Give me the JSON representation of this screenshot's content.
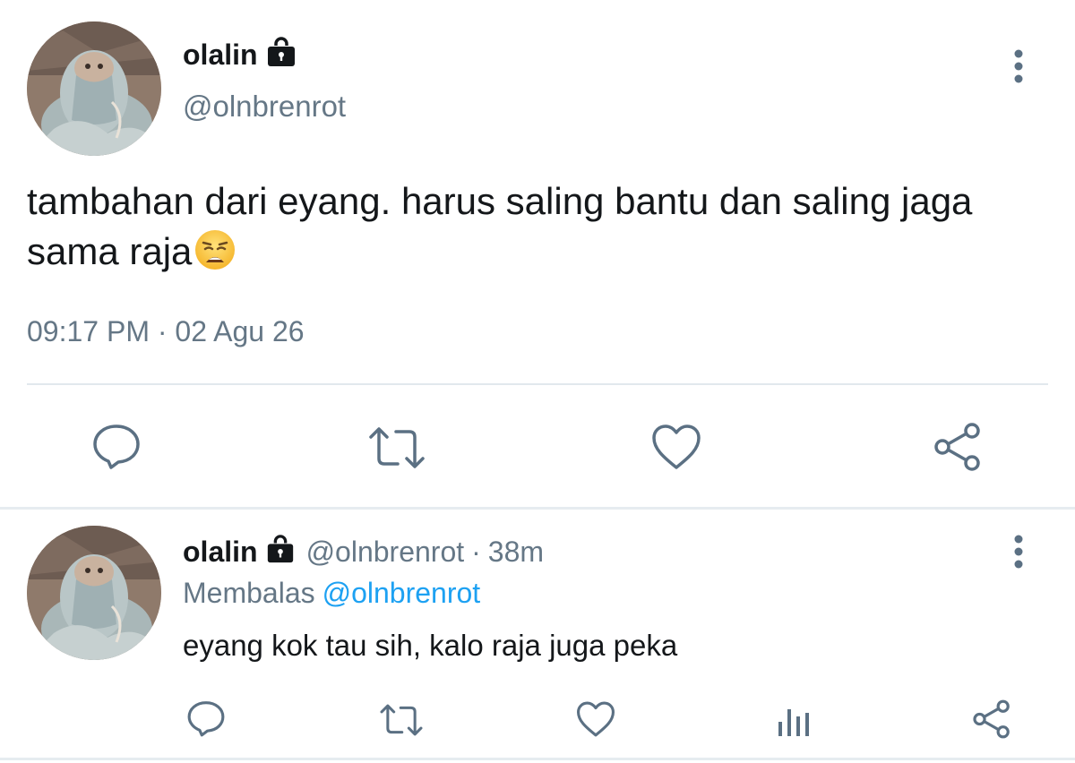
{
  "main_tweet": {
    "display_name": "olalin",
    "handle": "@olnbrenrot",
    "text": "tambahan dari eyang. harus saling bantu dan saling jaga sama raja",
    "emoji": "weary-face",
    "timestamp": "09:17 PM · 02 Agu 26",
    "protected_icon": "lock-icon",
    "actions": [
      "reply-icon",
      "retweet-icon",
      "like-icon",
      "share-icon"
    ]
  },
  "reply_tweet": {
    "display_name": "olalin",
    "handle": "@olnbrenrot",
    "separator": "·",
    "time_ago": "38m",
    "replying_prefix": "Membalas",
    "replying_to": "@olnbrenrot",
    "text": "eyang kok tau sih, kalo raja juga peka",
    "protected_icon": "lock-icon",
    "actions": [
      "reply-icon",
      "retweet-icon",
      "like-icon",
      "analytics-icon",
      "share-icon"
    ]
  },
  "colors": {
    "text_primary": "#14171a",
    "text_secondary": "#657786",
    "link": "#1da1f2",
    "icon": "#5b7083",
    "divider": "#e1e8ed"
  }
}
